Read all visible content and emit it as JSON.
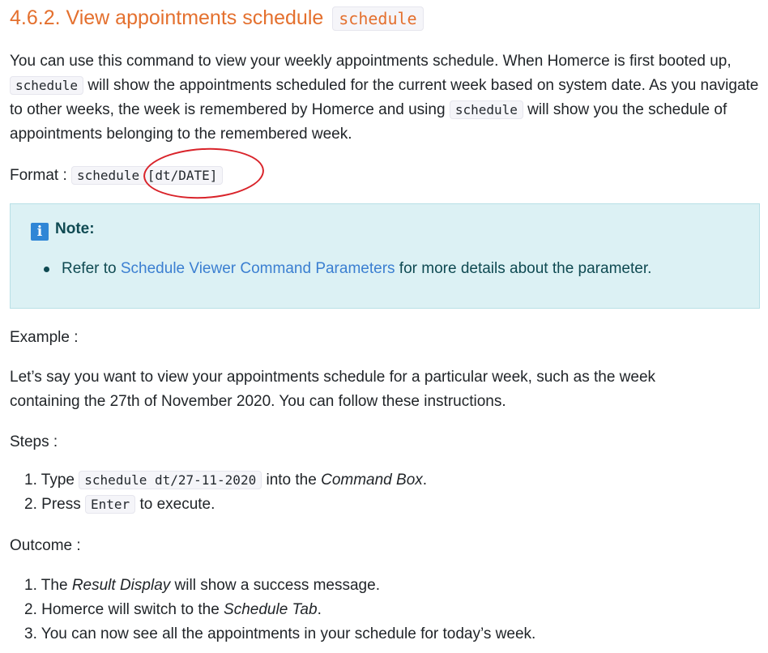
{
  "heading": {
    "text": "4.6.2. View appointments schedule",
    "code": "schedule"
  },
  "intro": {
    "part1": "You can use this command to view your weekly appointments schedule. When Homerce is first booted up, ",
    "code1": "schedule",
    "part2": " will show the appointments scheduled for the current week based on system date. As you navigate to other weeks, the week is remembered by Homerce and using ",
    "code2": "schedule",
    "part3": " will show you the schedule of appointments belonging to the remembered week."
  },
  "format": {
    "label": "Format : ",
    "code": "schedule [dt/DATE]"
  },
  "note": {
    "icon": "info-icon",
    "title": "Note:",
    "bullet_prefix": "Refer to ",
    "link": "Schedule Viewer Command Parameters",
    "bullet_suffix": " for more details about the parameter."
  },
  "example_label": "Example :",
  "example_text": "Let’s say you want to view your appointments schedule for a particular week, such as the week containing the 27th of November 2020. You can follow these instructions.",
  "steps_label": "Steps :",
  "steps": [
    {
      "num": "1.",
      "pre": "Type ",
      "code": "schedule dt/27-11-2020",
      "mid": " into the ",
      "em": "Command Box",
      "post": "."
    },
    {
      "num": "2.",
      "pre": "Press ",
      "code": "Enter",
      "mid": " to execute.",
      "em": "",
      "post": ""
    }
  ],
  "outcome_label": "Outcome :",
  "outcomes": [
    {
      "num": "1.",
      "pre": "The ",
      "em": "Result Display",
      "post": " will show a success message."
    },
    {
      "num": "2.",
      "pre": "Homerce will switch to the ",
      "em": "Schedule Tab",
      "post": "."
    },
    {
      "num": "3.",
      "pre": "You can now see all the appointments in your schedule for today’s week.",
      "em": "",
      "post": ""
    }
  ],
  "colors": {
    "heading": "#e4702e",
    "note_bg": "#dcf1f4",
    "link": "#3b7fd1",
    "annotation": "#d9232a"
  }
}
